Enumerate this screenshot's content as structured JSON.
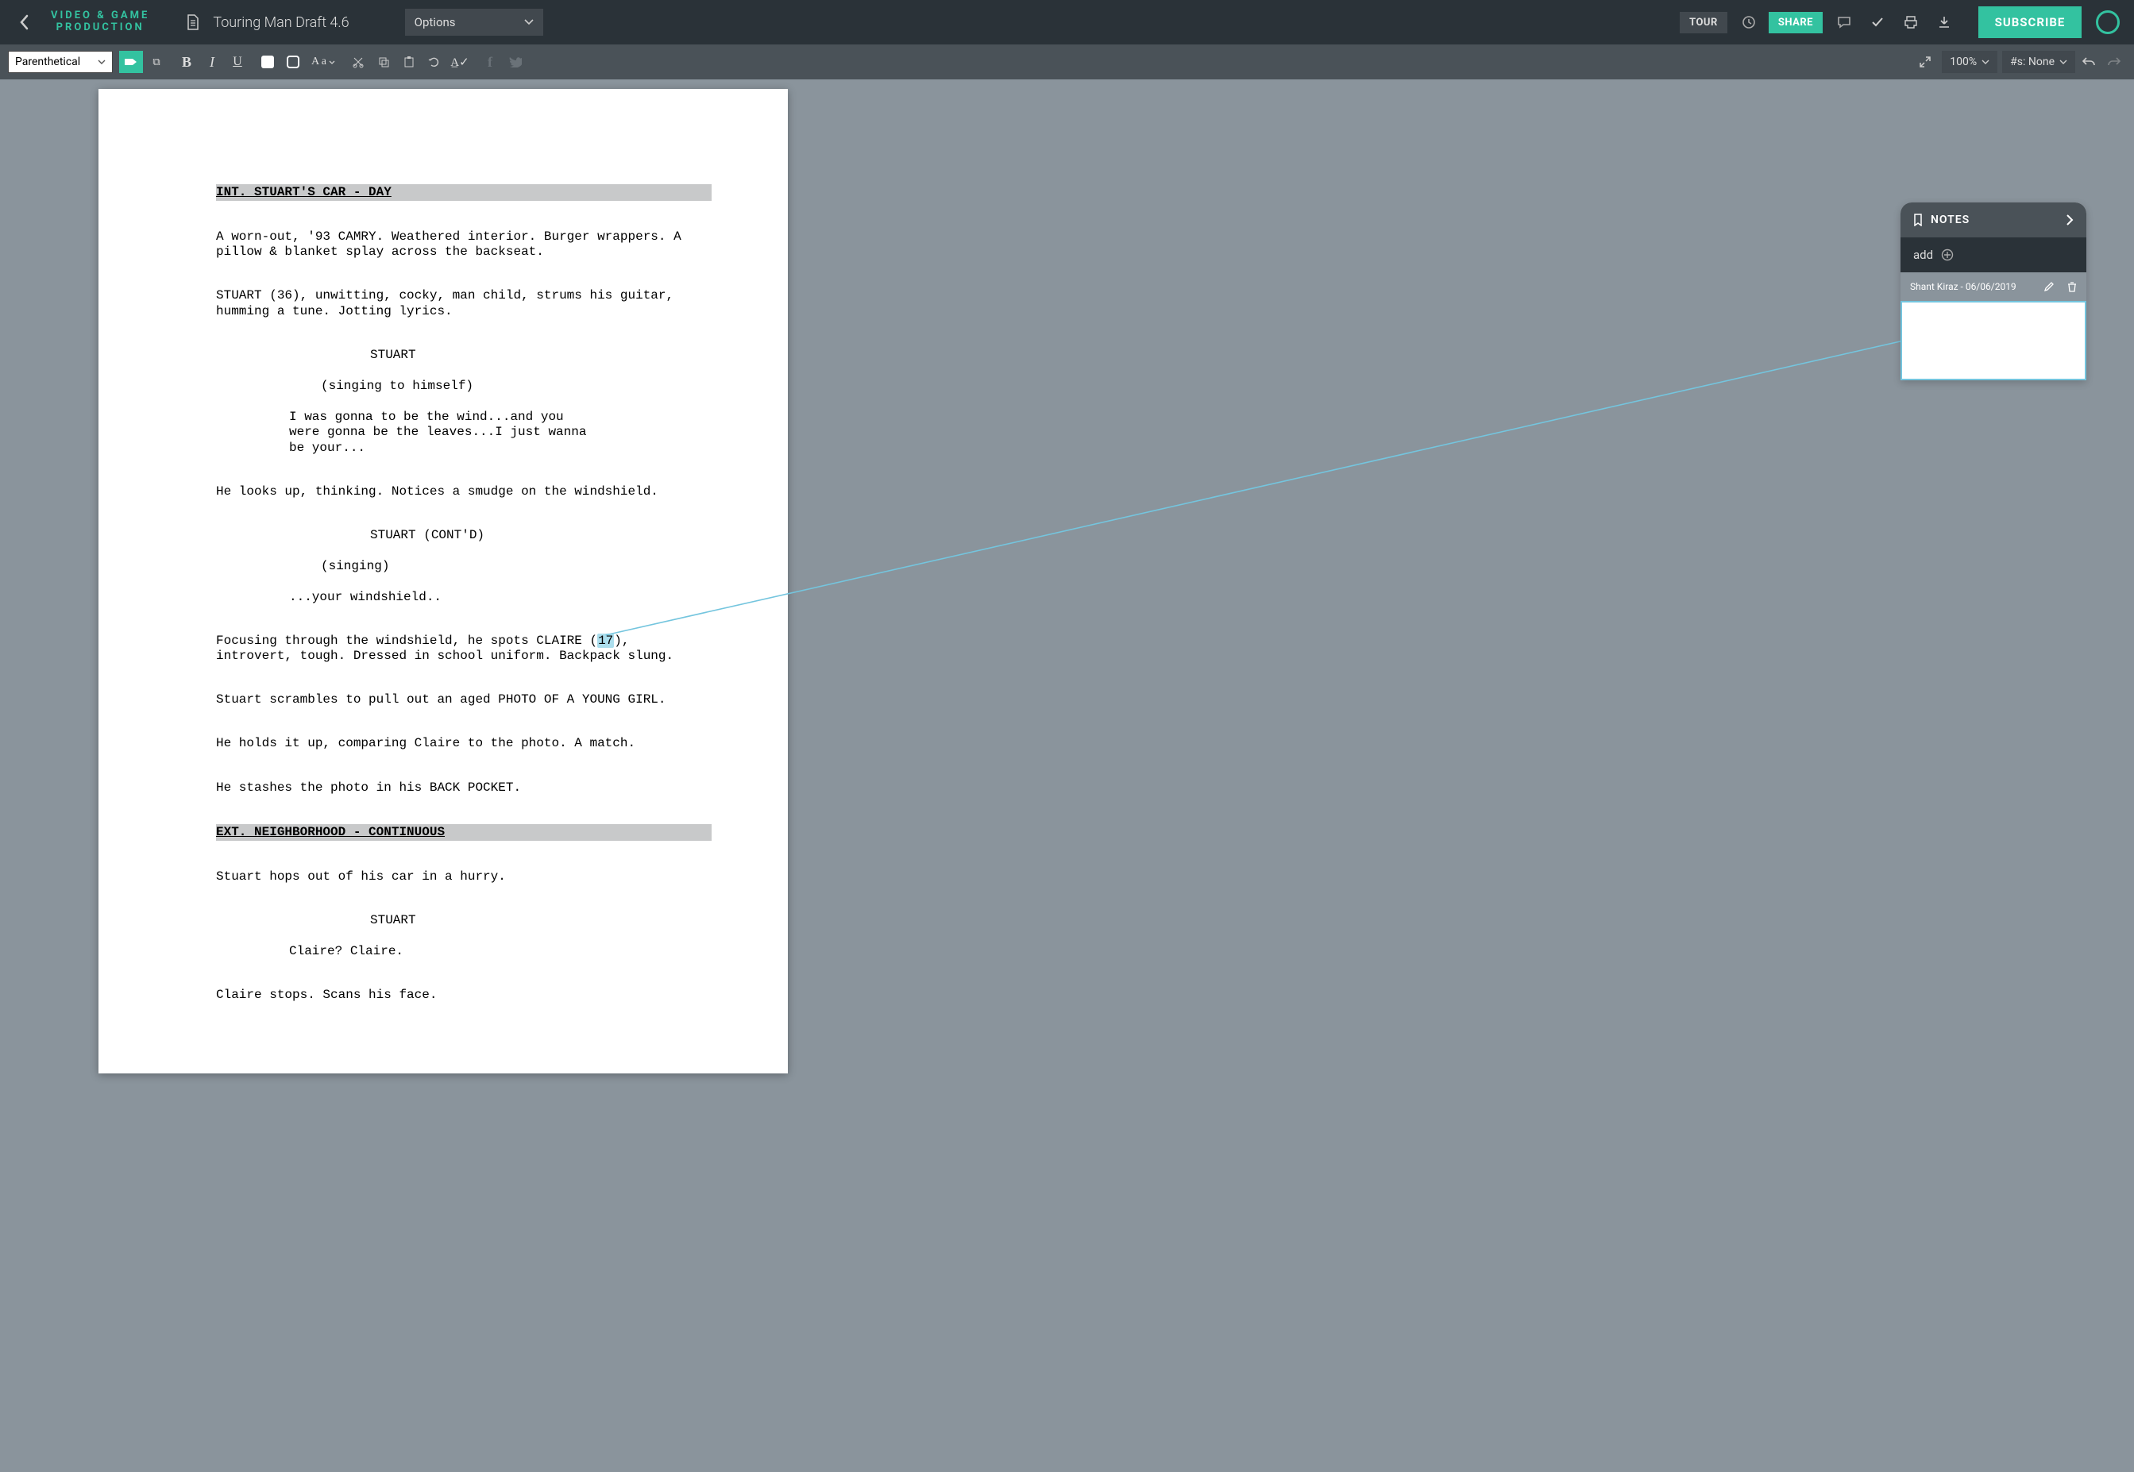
{
  "brand": {
    "line1": "VIDEO & GAME",
    "line2": "PRODUCTION"
  },
  "document": {
    "title": "Touring Man Draft 4.6"
  },
  "topbar": {
    "options": "Options",
    "tour": "TOUR",
    "share": "SHARE",
    "subscribe": "SUBSCRIBE"
  },
  "toolbar": {
    "element_type": "Parenthetical",
    "zoom": "100%",
    "scene_num": "#s: None",
    "case_label": "A a"
  },
  "script": {
    "scene1_heading": "INT. STUART'S CAR - DAY",
    "action1": "A worn-out, '93 CAMRY. Weathered interior. Burger wrappers. A pillow & blanket splay across the backseat.",
    "action2": "STUART (36), unwitting, cocky, man child, strums his guitar, humming a tune. Jotting lyrics.",
    "char1": "STUART",
    "paren1": "(singing to himself)",
    "dialog1": "I was gonna to be the wind...and you were gonna be the leaves...I just wanna be your...",
    "action3": "He looks up, thinking. Notices a smudge on the windshield.",
    "char2": "STUART (CONT'D)",
    "paren2": "(singing)",
    "dialog2": "...your windshield..",
    "action4a": "Focusing through the windshield, he spots CLAIRE (",
    "action4_hook": "17",
    "action4b": "), introvert, tough. Dressed in school uniform. Backpack slung.",
    "action5": "Stuart scrambles to pull out an aged PHOTO OF A YOUNG GIRL.",
    "action6": "He holds it up, comparing Claire to the photo. A match.",
    "action7": "He stashes the photo in his BACK POCKET.",
    "scene2_heading": "EXT. NEIGHBORHOOD - CONTINUOUS",
    "action8": "Stuart hops out of his car in a hurry.",
    "char3": "STUART",
    "dialog3": "Claire? Claire.",
    "action9": "Claire stops. Scans his face."
  },
  "notes": {
    "title": "NOTES",
    "add": "add",
    "note1_author": "Shant Kiraz - 06/06/2019"
  }
}
